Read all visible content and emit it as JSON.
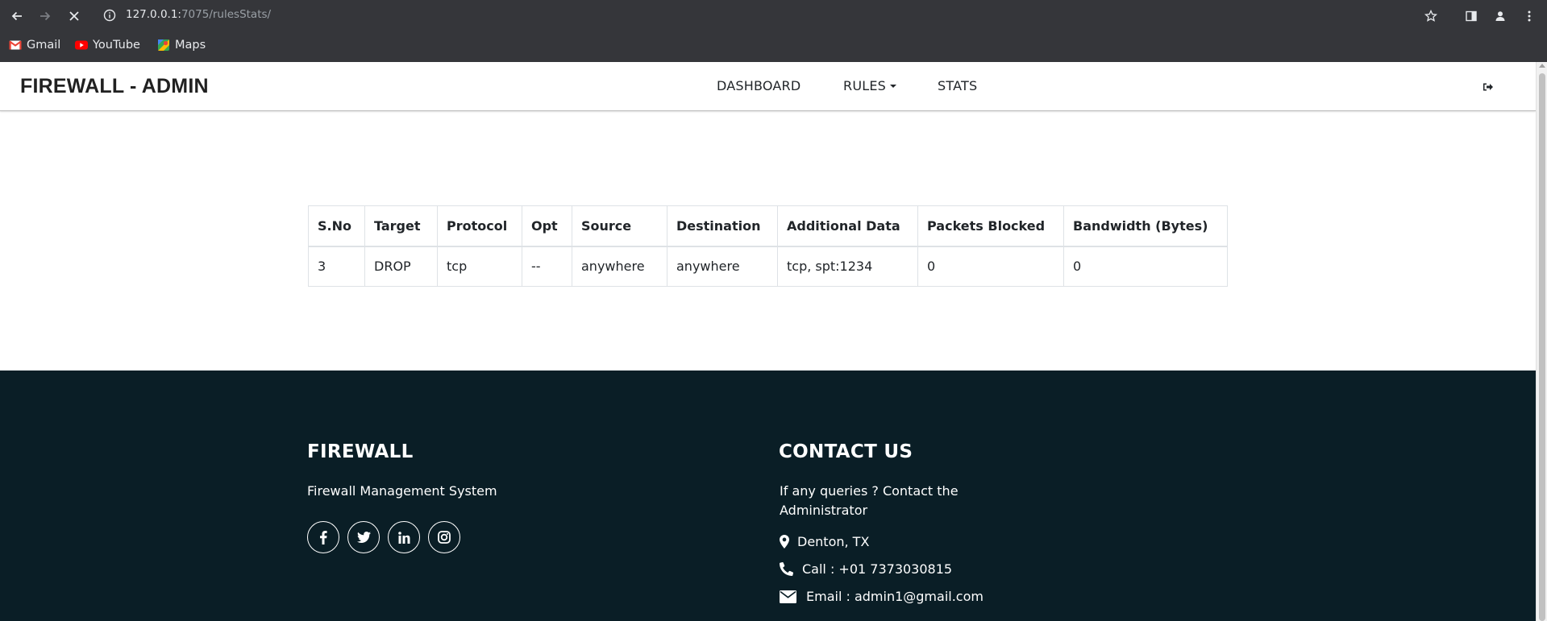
{
  "browser": {
    "url_host": "127.0.0.1:",
    "url_rest": "7075/rulesStats/",
    "bookmarks": [
      {
        "label": "Gmail",
        "icon": "gmail-icon"
      },
      {
        "label": "YouTube",
        "icon": "youtube-icon"
      },
      {
        "label": "Maps",
        "icon": "maps-icon"
      }
    ]
  },
  "header": {
    "brand": "FIREWALL - ADMIN",
    "nav": {
      "dashboard": "DASHBOARD",
      "rules": "RULES",
      "stats": "STATS"
    }
  },
  "table": {
    "columns": [
      "S.No",
      "Target",
      "Protocol",
      "Opt",
      "Source",
      "Destination",
      "Additional Data",
      "Packets Blocked",
      "Bandwidth (Bytes)"
    ],
    "rows": [
      [
        "3",
        "DROP",
        "tcp",
        "--",
        "anywhere",
        "anywhere",
        "tcp, spt:1234",
        "0",
        "0"
      ]
    ]
  },
  "footer": {
    "brand_title": "FIREWALL",
    "brand_tagline": "Firewall Management System",
    "contact_title": "CONTACT US",
    "contact_text": "If any queries ? Contact the Administrator",
    "location": "Denton, TX",
    "phone": "Call : +01 7373030815",
    "email": "Email : admin1@gmail.com",
    "socials": [
      "facebook-icon",
      "twitter-icon",
      "linkedin-icon",
      "instagram-icon"
    ]
  },
  "colors": {
    "chrome": "#35363a",
    "footer_bg": "#0a1e26",
    "text": "#212529"
  }
}
